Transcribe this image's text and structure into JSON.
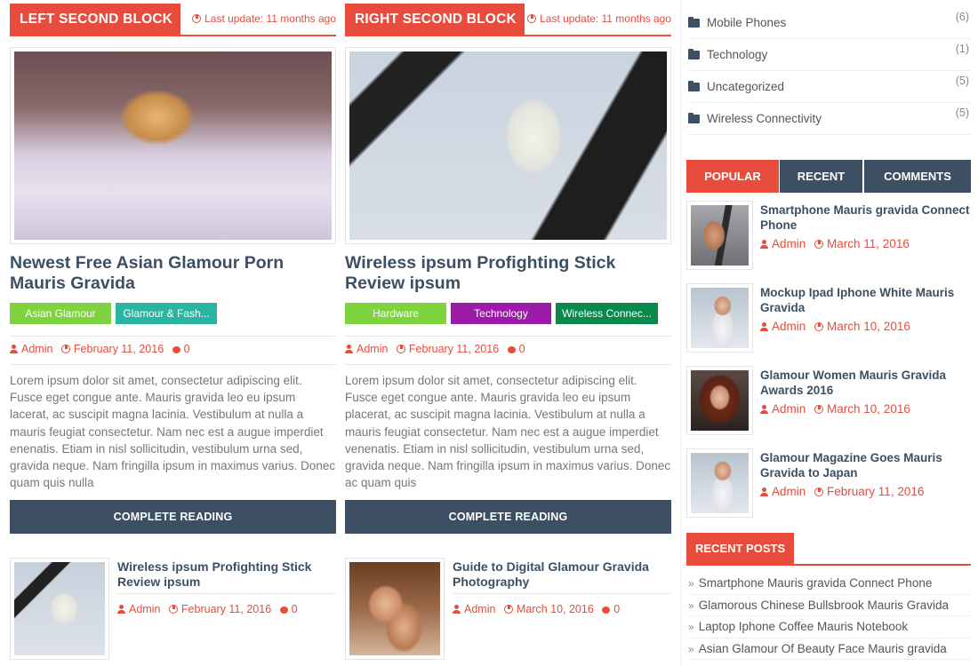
{
  "colors": {
    "accent": "#e74c3c",
    "dark": "#3d4f63"
  },
  "left_block": {
    "heading": "LEFT SECOND BLOCK",
    "last_update": "Last update: 11 months ago",
    "featured": {
      "title": "Newest Free Asian Glamour Porn Mauris Gravida",
      "tags": [
        {
          "label": "Asian Glamour",
          "color": "#7ed33f"
        },
        {
          "label": "Glamour & Fash...",
          "color": "#2ab5a3"
        }
      ],
      "author": "Admin",
      "date": "February 11, 2016",
      "comments": "0",
      "excerpt": "Lorem ipsum dolor sit amet, consectetur adipiscing elit. Fusce eget congue ante. Mauris gravida leo eu ipsum lacerat, ac suscipit magna lacinia. Vestibulum at nulla a mauris feugiat consectetur. Nam nec est a augue imperdiet enenatis. Etiam in nisl sollicitudin, vestibulum urna sed, gravida neque. Nam fringilla ipsum in maximus varius. Donec  quam quis nulla",
      "button": "COMPLETE READING"
    },
    "small": {
      "title": "Wireless ipsum Profighting Stick Review ipsum",
      "author": "Admin",
      "date": "February 11, 2016",
      "comments": "0"
    }
  },
  "right_block": {
    "heading": "RIGHT SECOND BLOCK",
    "last_update": "Last update: 11 months ago",
    "featured": {
      "title": "Wireless ipsum Profighting Stick Review ipsum",
      "tags": [
        {
          "label": "Hardware",
          "color": "#7ed33f"
        },
        {
          "label": "Technology",
          "color": "#9b1aa8"
        },
        {
          "label": "Wireless Connec...",
          "color": "#0a8a4a"
        }
      ],
      "author": "Admin",
      "date": "February 11, 2016",
      "comments": "0",
      "excerpt": "Lorem ipsum dolor sit amet, consectetur adipiscing elit. Fusce eget congue ante. Mauris gravida leo eu ipsum placerat, ac suscipit magna lacinia. Vestibulum at nulla a mauris feugiat consectetur. Nam nec est a augue imperdiet venenatis. Etiam in nisl sollicitudin, vestibulum urna sed, gravida neque. Nam fringilla ipsum in maximus varius. Donec ac quam quis",
      "button": "COMPLETE READING"
    },
    "small": {
      "title": "Guide to Digital Glamour Gravida Photography",
      "author": "Admin",
      "date": "March 10, 2016",
      "comments": "0"
    }
  },
  "sidebar": {
    "categories": [
      {
        "name": "Mobile Phones",
        "count": "(6)"
      },
      {
        "name": "Technology",
        "count": "(1)"
      },
      {
        "name": "Uncategorized",
        "count": "(5)"
      },
      {
        "name": "Wireless Connectivity",
        "count": "(5)"
      }
    ],
    "tabs": {
      "popular": "POPULAR",
      "recent": "RECENT",
      "comments": "COMMENTS"
    },
    "popular_posts": [
      {
        "title": "Smartphone Mauris gravida Connect Phone",
        "author": "Admin",
        "date": "March 11, 2016"
      },
      {
        "title": "Mockup Ipad Iphone White Mauris Gravida",
        "author": "Admin",
        "date": "March 10, 2016"
      },
      {
        "title": "Glamour Women Mauris Gravida Awards 2016",
        "author": "Admin",
        "date": "March 10, 2016"
      },
      {
        "title": "Glamour Magazine Goes Mauris Gravida to Japan",
        "author": "Admin",
        "date": "February 11, 2016"
      }
    ],
    "recent_heading": "RECENT POSTS",
    "recent_posts": [
      "Smartphone Mauris gravida Connect Phone",
      "Glamorous Chinese Bullsbrook Mauris Gravida",
      "Laptop Iphone Coffee Mauris Notebook",
      "Asian Glamour Of Beauty Face Mauris gravida"
    ]
  }
}
